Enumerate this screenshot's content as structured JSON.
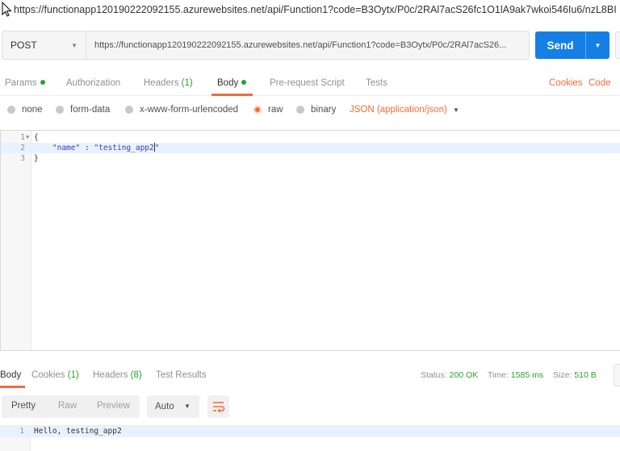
{
  "window": {
    "url_title": "https://functionapp120190222092155.azurewebsites.net/api/Function1?code=B3Oytx/P0c/2RAl7acS26fc1O1lA9ak7wkoi546Iu6/nzL8BI"
  },
  "request": {
    "method": "POST",
    "url": "https://functionapp120190222092155.azurewebsites.net/api/Function1?code=B3Oytx/P0c/2RAl7acS26...",
    "send_label": "Send"
  },
  "request_tabs": {
    "params": "Params",
    "authorization": "Authorization",
    "headers": "Headers",
    "headers_count": "(1)",
    "body": "Body",
    "pre_request": "Pre-request Script",
    "tests": "Tests",
    "cookies_link": "Cookies",
    "code_link": "Code"
  },
  "body_types": {
    "none": "none",
    "form_data": "form-data",
    "urlencoded": "x-www-form-urlencoded",
    "raw": "raw",
    "binary": "binary",
    "content_type": "JSON (application/json)"
  },
  "editor": {
    "lines": [
      {
        "num": "1",
        "text": "{"
      },
      {
        "num": "2",
        "key": "\"name\"",
        "sep": " : ",
        "value": "\"testing_app2",
        "end": "\""
      },
      {
        "num": "3",
        "text": "}"
      }
    ]
  },
  "response_tabs": {
    "body": "Body",
    "cookies": "Cookies",
    "cookies_count": "(1)",
    "headers": "Headers",
    "headers_count": "(8)",
    "test_results": "Test Results",
    "status_label": "Status:",
    "status_value": "200 OK",
    "time_label": "Time:",
    "time_value": "1585 ms",
    "size_label": "Size:",
    "size_value": "510 B"
  },
  "response_toolbar": {
    "pretty": "Pretty",
    "raw": "Raw",
    "preview": "Preview",
    "format": "Auto"
  },
  "response_body": {
    "lines": [
      {
        "num": "1",
        "text": "Hello, testing_app2"
      }
    ]
  },
  "colors": {
    "accent": "#f26b3a",
    "send": "#157fe6",
    "success": "#29a329"
  }
}
